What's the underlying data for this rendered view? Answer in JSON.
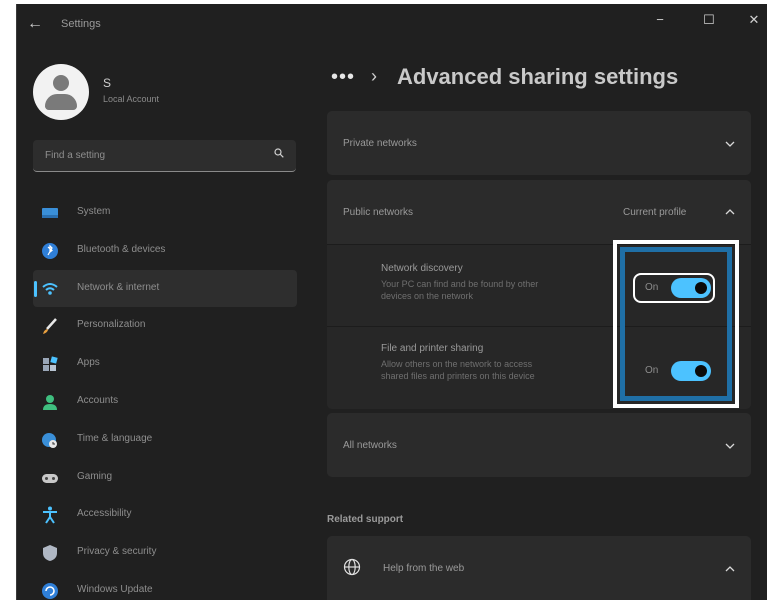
{
  "window": {
    "title": "Settings",
    "back_glyph": "←",
    "minimize": "−",
    "maximize": "☐",
    "close": "✕"
  },
  "profile": {
    "name": "S",
    "account_type": "Local Account"
  },
  "search": {
    "placeholder": "Find a setting"
  },
  "nav": {
    "items": [
      {
        "label": "System",
        "icon": "system-icon",
        "active": false
      },
      {
        "label": "Bluetooth & devices",
        "icon": "bluetooth-icon",
        "active": false
      },
      {
        "label": "Network & internet",
        "icon": "wifi-icon",
        "active": true
      },
      {
        "label": "Personalization",
        "icon": "brush-icon",
        "active": false
      },
      {
        "label": "Apps",
        "icon": "apps-icon",
        "active": false
      },
      {
        "label": "Accounts",
        "icon": "accounts-icon",
        "active": false
      },
      {
        "label": "Time & language",
        "icon": "time-language-icon",
        "active": false
      },
      {
        "label": "Gaming",
        "icon": "gaming-icon",
        "active": false
      },
      {
        "label": "Accessibility",
        "icon": "accessibility-icon",
        "active": false
      },
      {
        "label": "Privacy & security",
        "icon": "shield-icon",
        "active": false
      },
      {
        "label": "Windows Update",
        "icon": "update-icon",
        "active": false
      }
    ]
  },
  "breadcrumb": {
    "more": "•••",
    "separator": "›",
    "title": "Advanced sharing settings"
  },
  "sections": {
    "private": {
      "label": "Private networks"
    },
    "public": {
      "label": "Public networks",
      "status": "Current profile",
      "network_discovery": {
        "title": "Network discovery",
        "description": "Your PC can find and be found by other devices on the network",
        "state_label": "On",
        "on": true
      },
      "file_printer_sharing": {
        "title": "File and printer sharing",
        "description": "Allow others on the network to access shared files and printers on this device",
        "state_label": "On",
        "on": true
      }
    },
    "all": {
      "label": "All networks"
    }
  },
  "related": {
    "heading": "Related support",
    "help_label": "Help from the web"
  },
  "colors": {
    "accent": "#4cc2ff",
    "highlight": "#1f6fa6",
    "background": "#202020",
    "card": "#2b2b2b"
  }
}
